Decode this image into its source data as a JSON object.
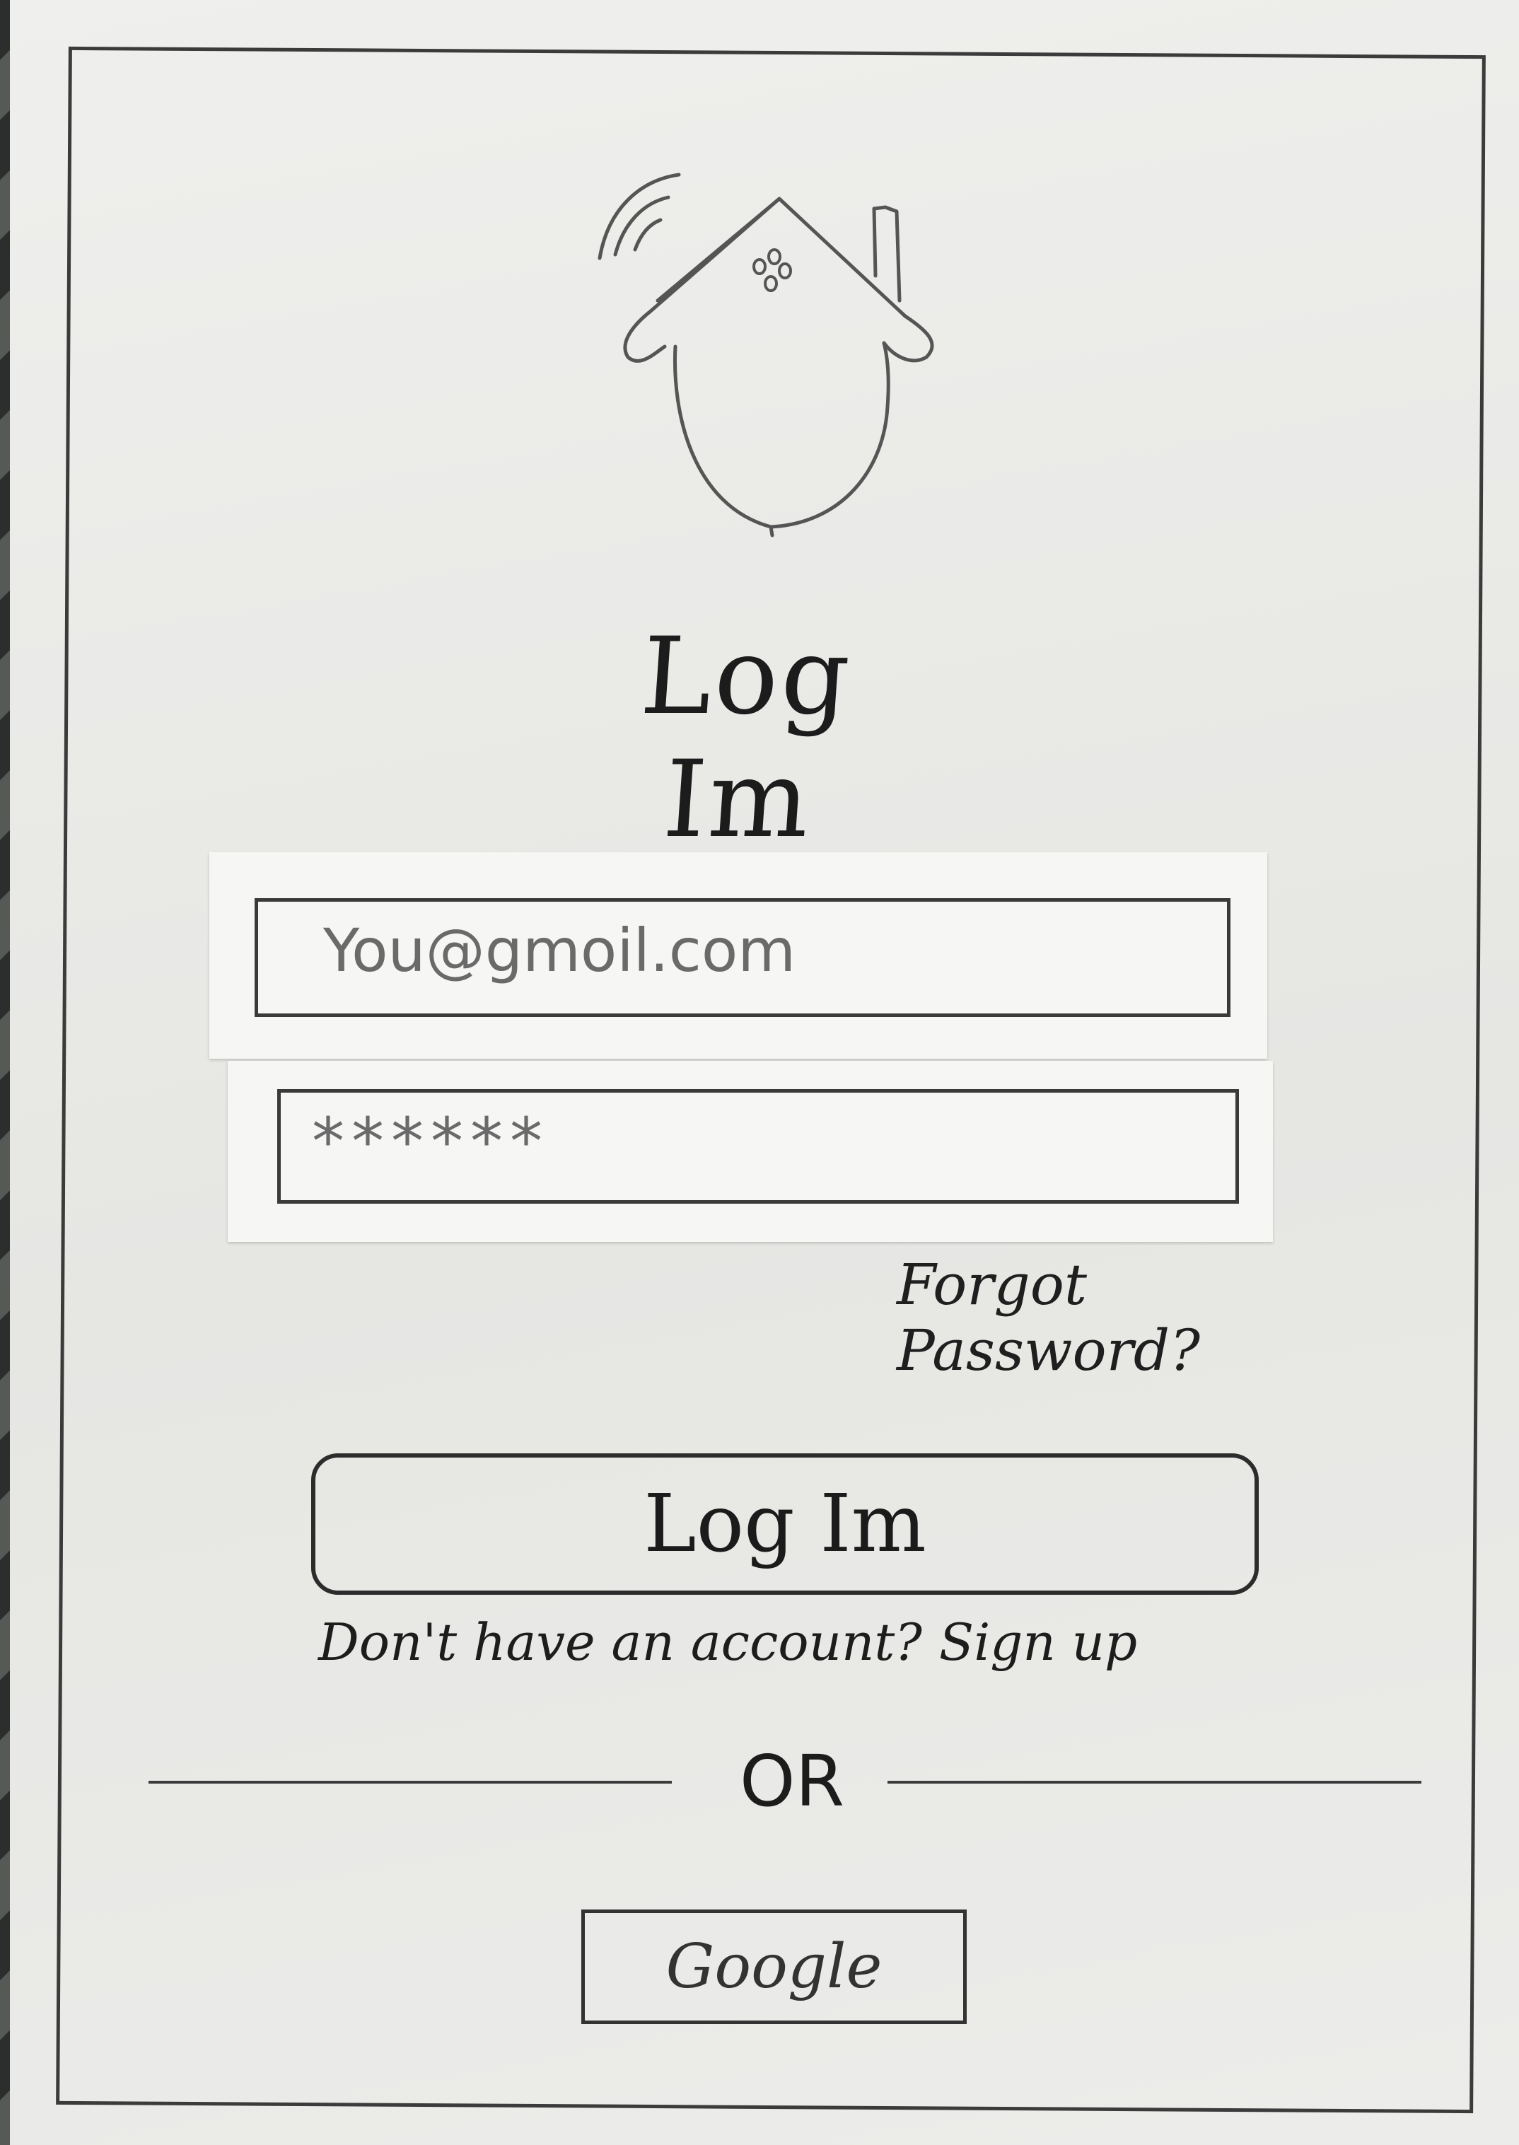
{
  "screen": {
    "title": "Log Im",
    "logo_icon": "house-wifi-icon"
  },
  "form": {
    "email_placeholder": "You@gmoil.com",
    "password_placeholder": "******",
    "forgot_label": "Forgot Password?"
  },
  "actions": {
    "login_label": "Log Im",
    "signup_prompt": "Don't have an account?",
    "signup_link": "Sign up",
    "divider_label": "OR",
    "google_label": "Google"
  }
}
